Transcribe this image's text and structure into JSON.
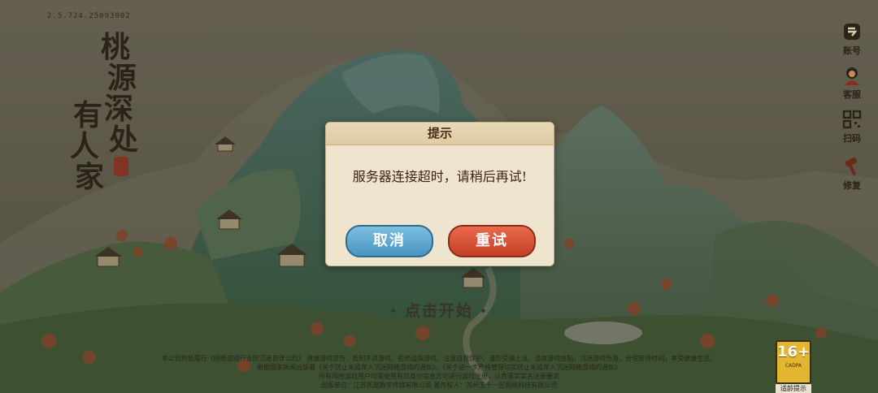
{
  "version": "2.5.724.25093002",
  "logo": {
    "chars": [
      "桃",
      "源",
      "深",
      "处",
      "有",
      "人",
      "家"
    ]
  },
  "sidebar": [
    {
      "label": "账号",
      "icon": "account-icon"
    },
    {
      "label": "客服",
      "icon": "customer-service-icon"
    },
    {
      "label": "扫码",
      "icon": "qr-code-icon"
    },
    {
      "label": "修复",
      "icon": "repair-hammer-icon"
    }
  ],
  "start_text": "点击开始",
  "notice": {
    "line1": "本公司积极履行《网络游戏行业防沉迷自律公约》 健康游戏忠告：抵制不良游戏，拒绝盗版游戏。注意自我保护，谨防受骗上当。适度游戏益脑，沉迷游戏伤身。合理安排时间，享受健康生活。",
    "line2": "根据国家新闻出版署《关于防止未成年人沉迷网络游戏的通知》、《关于进一步严格管理切实防止未成年人沉迷网络游戏的通知》",
    "line3": "所有网络游戏用户均需使用有效身份信息方可进行游戏注册，认真落实实名注册要求",
    "line4": "出版单位：江苏凤凰数字传媒有限公司  著作权人：苏州五十一区网络科技有限公司"
  },
  "age_rating": {
    "number": "16+",
    "sub": "CADPA",
    "label": "适龄提示"
  },
  "dialog": {
    "title": "提示",
    "message": "服务器连接超时，请稍后再试!",
    "cancel_label": "取消",
    "retry_label": "重试"
  }
}
